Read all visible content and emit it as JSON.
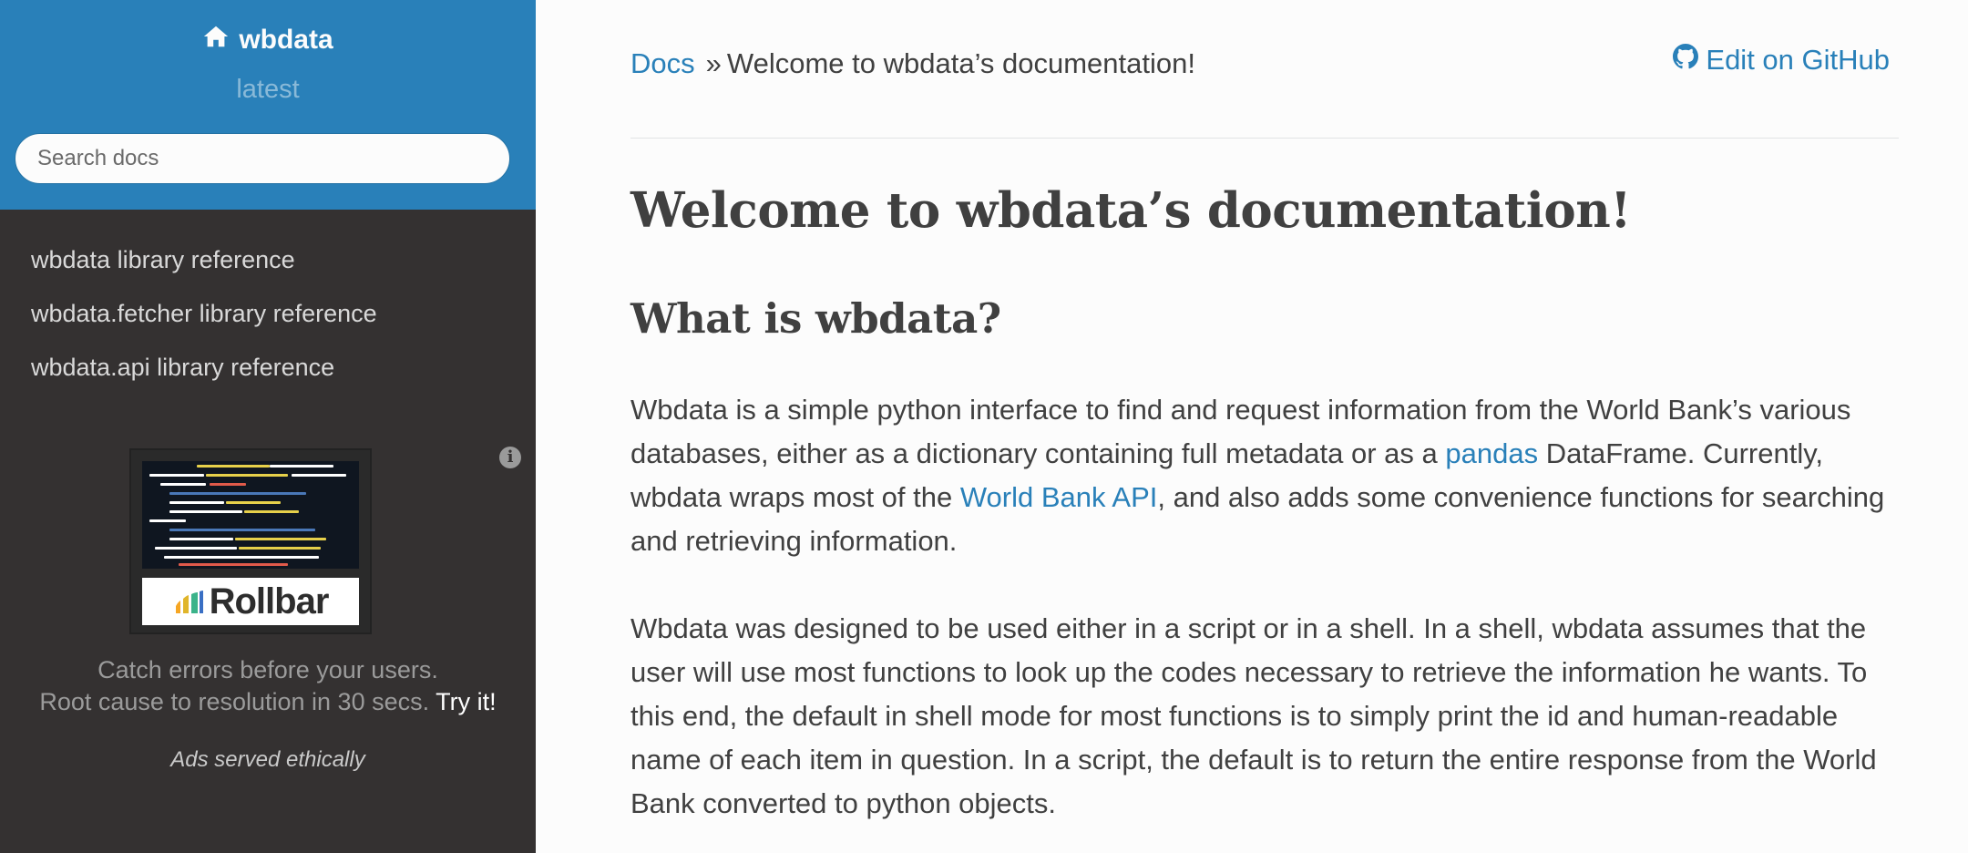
{
  "sidebar": {
    "brand": "wbdata",
    "version": "latest",
    "search_placeholder": "Search docs",
    "nav": [
      "wbdata library reference",
      "wbdata.fetcher library reference",
      "wbdata.api library reference"
    ],
    "ad": {
      "logo_text": "Rollbar",
      "line1": "Catch errors before your users.",
      "line2": "Root cause to resolution in 30 secs.",
      "cta": "Try it!",
      "ethical": "Ads served ethically"
    }
  },
  "breadcrumb": {
    "root": "Docs",
    "separator": "»",
    "current": "Welcome to wbdata’s documentation!",
    "edit_link": "Edit on GitHub"
  },
  "main": {
    "title": "Welcome to wbdata’s documentation!",
    "subtitle": "What is wbdata?",
    "p1": {
      "a": "Wbdata is a simple python interface to find and request information from the World Bank’s various databases, either as a dictionary containing full metadata or as a ",
      "link1": "pandas",
      "b": " DataFrame. Currently, wbdata wraps most of the ",
      "link2": "World Bank API",
      "c": ", and also adds some convenience functions for searching and retrieving information."
    },
    "p2": "Wbdata was designed to be used either in a script or in a shell. In a shell, wbdata assumes that the user will use most functions to look up the codes necessary to retrieve the information he wants. To this end, the default in shell mode for most functions is to simply print the id and human-readable name of each item in question. In a script, the default is to return the entire response from the World Bank converted to python objects."
  },
  "colors": {
    "accent": "#2980b9",
    "sidebar_bg": "#343131",
    "content_bg": "#fcfcfc"
  }
}
